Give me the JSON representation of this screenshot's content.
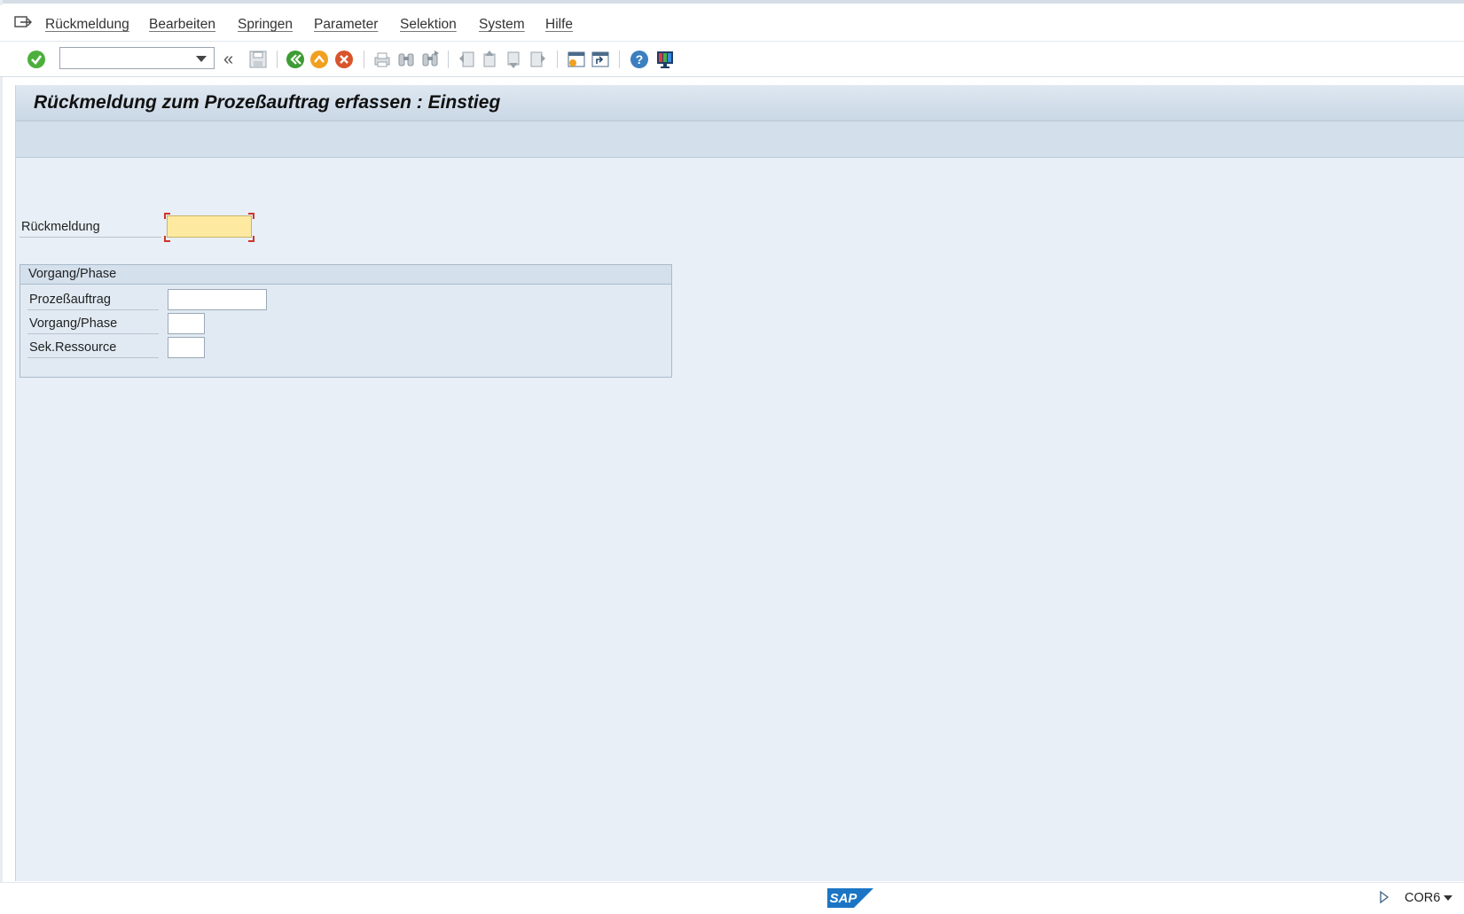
{
  "menu": {
    "items": [
      "Rückmeldung",
      "Bearbeiten",
      "Springen",
      "Parameter",
      "Selektion",
      "System",
      "Hilfe"
    ]
  },
  "toolbar": {
    "command_field_value": "",
    "icons": [
      "enter-icon",
      "back-icon",
      "exit-icon",
      "cancel-icon",
      "save-icon",
      "print-icon",
      "find-icon",
      "find-next-icon",
      "first-page-icon",
      "previous-page-icon",
      "next-page-icon",
      "last-page-icon",
      "new-session-icon",
      "shortcut-icon",
      "help-icon",
      "customize-layout-icon"
    ]
  },
  "screen": {
    "title": "Rückmeldung zum Prozeßauftrag erfassen : Einstieg"
  },
  "form": {
    "rueckmeldung_label": "Rückmeldung",
    "rueckmeldung_value": "",
    "group_title": "Vorgang/Phase",
    "prozessauftrag_label": "Prozeßauftrag",
    "prozessauftrag_value": "",
    "vorgang_label": "Vorgang/Phase",
    "vorgang_value": "",
    "sek_label": "Sek.Ressource",
    "sek_value": ""
  },
  "status": {
    "logo_text": "SAP",
    "transaction": "COR6"
  },
  "colors": {
    "required_field": "#fdeaa0",
    "work_area": "#e8eff6",
    "sap_blue": "#1b75c4"
  }
}
